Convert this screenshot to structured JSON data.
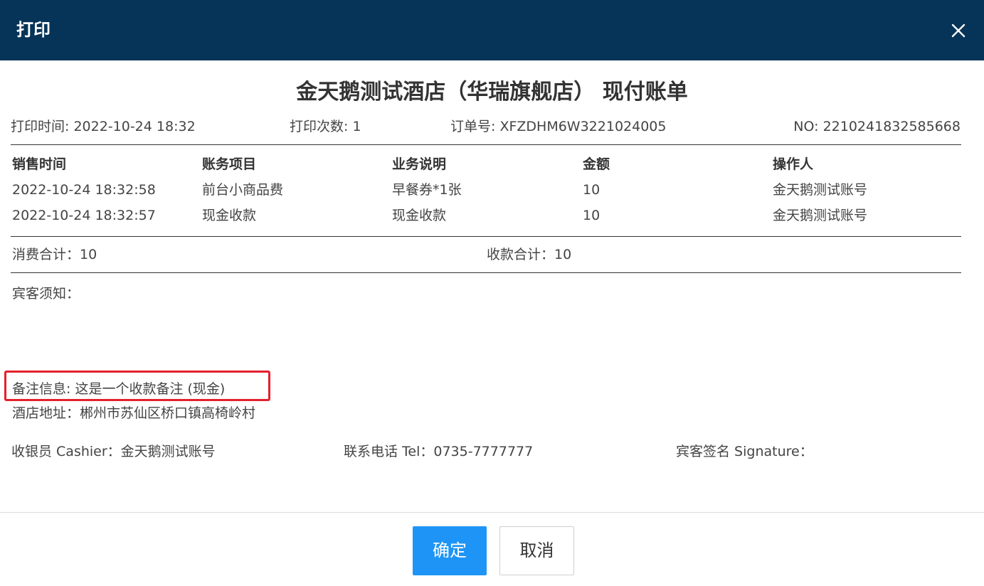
{
  "dialog": {
    "title": "打印",
    "close_icon": "close-icon",
    "header_color": "#063458"
  },
  "bill": {
    "title": "金天鹅测试酒店（华瑞旗舰店） 现付账单",
    "print_time": "打印时间: 2022-10-24 18:32",
    "print_count": "打印次数: 1",
    "order_no": "订单号: XFZDHM6W3221024005",
    "no": "NO: 2210241832585668"
  },
  "table": {
    "headers": [
      "销售时间",
      "账务项目",
      "业务说明",
      "金额",
      "操作人"
    ],
    "rows": [
      [
        "2022-10-24 18:32:58",
        "前台小商品费",
        "早餐券*1张",
        "10",
        "金天鹅测试账号"
      ],
      [
        "2022-10-24 18:32:57",
        "现金收款",
        "现金收款",
        "10",
        "金天鹅测试账号"
      ]
    ]
  },
  "totals": {
    "consumption": "消费合计：10",
    "payment": "收款合计：10"
  },
  "notes": {
    "guest_notice": "宾客须知：",
    "remark": "备注信息:  这是一个收款备注 (现金)",
    "address": "酒店地址：郴州市苏仙区桥口镇高椅岭村",
    "highlight_color": "#e4202d"
  },
  "signatures": {
    "cashier": "收银员 Cashier：金天鹅测试账号",
    "phone": "联系电话 Tel：0735-7777777",
    "guest_signature": "宾客签名 Signature："
  },
  "buttons": {
    "ok": "确定",
    "cancel": "取消",
    "ok_color": "#1e95f6"
  }
}
